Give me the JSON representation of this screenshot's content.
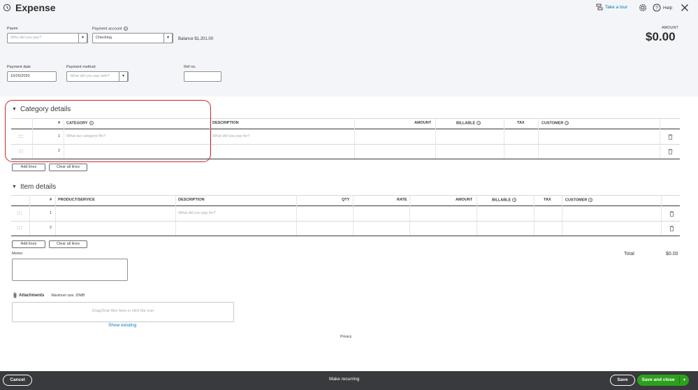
{
  "header": {
    "title": "Expense",
    "take_tour": "Take a tour",
    "help": "Help",
    "amount_label": "AMOUNT",
    "amount_value": "$0.00"
  },
  "payee": {
    "label": "Payee",
    "placeholder": "Who did you pay?"
  },
  "payment_account": {
    "label": "Payment account",
    "value": "Checking",
    "balance": "Balance $1,201.00"
  },
  "payment_date": {
    "label": "Payment date",
    "value": "10/25/2020"
  },
  "payment_method": {
    "label": "Payment method",
    "placeholder": "What did you pay with?"
  },
  "ref_no": {
    "label": "Ref no."
  },
  "category_details": {
    "title": "Category details",
    "columns": {
      "num": "#",
      "category": "CATEGORY",
      "description": "DESCRIPTION",
      "amount": "AMOUNT",
      "billable": "BILLABLE",
      "tax": "TAX",
      "customer": "CUSTOMER"
    },
    "rows": [
      {
        "num": "1",
        "category_placeholder": "What tax category fits?",
        "description_placeholder": "What did you pay for?"
      },
      {
        "num": "2"
      }
    ],
    "add_lines": "Add lines",
    "clear_lines": "Clear all lines"
  },
  "item_details": {
    "title": "Item details",
    "columns": {
      "num": "#",
      "product": "PRODUCT/SERVICE",
      "description": "DESCRIPTION",
      "qty": "QTY",
      "rate": "RATE",
      "amount": "AMOUNT",
      "billable": "BILLABLE",
      "tax": "TAX",
      "customer": "CUSTOMER"
    },
    "rows": [
      {
        "num": "1",
        "description_placeholder": "What did you pay for?"
      },
      {
        "num": "2"
      }
    ],
    "add_lines": "Add lines",
    "clear_lines": "Clear all lines"
  },
  "total": {
    "label": "Total",
    "value": "$0.00"
  },
  "memo": {
    "label": "Memo"
  },
  "attachments": {
    "label": "Attachments",
    "max_size": "Maximum size: 20MB",
    "drop_text": "Drag/Drop files here or click the icon",
    "show_existing": "Show existing"
  },
  "privacy": "Privacy",
  "footer": {
    "cancel": "Cancel",
    "make_recurring": "Make recurring",
    "save": "Save",
    "save_and_close": "Save and close"
  },
  "colors": {
    "header_bg": "#f4f5f8",
    "footer_bg": "#393a3d",
    "primary_green": "#2ca01c",
    "link_blue": "#0077c5",
    "highlight_red": "#c9282d"
  },
  "icons": [
    "history-icon",
    "tour-icon",
    "gear-icon",
    "help-icon",
    "close-icon",
    "info-icon",
    "drag-handle-icon",
    "trash-icon",
    "paperclip-icon",
    "caret-down-icon"
  ]
}
